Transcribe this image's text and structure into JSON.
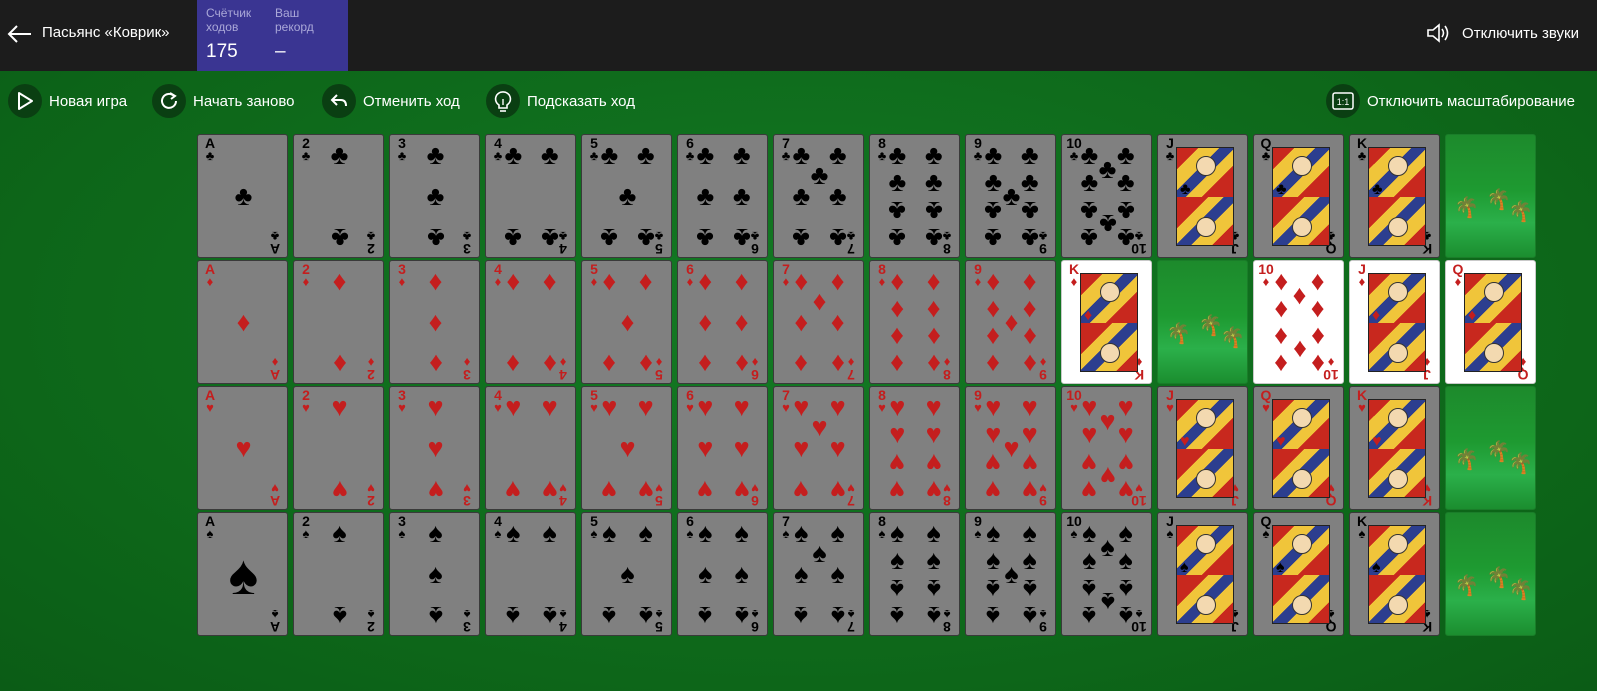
{
  "header": {
    "back_icon": "arrow-left-icon",
    "title": "Пасьянс «Коврик»",
    "moves_label": "Счётчик\nходов",
    "moves_value": "175",
    "record_label": "Ваш\nрекорд",
    "record_value": "–",
    "sound_label": "Отключить звуки",
    "sound_icon": "speaker-icon"
  },
  "toolbar": {
    "new_game": "Новая игра",
    "restart": "Начать заново",
    "undo": "Отменить ход",
    "hint": "Подсказать ход",
    "scaling": "Отключить масштабирование",
    "scaling_icon_text": "1:1"
  },
  "colors": {
    "felt": "#0f6a1c",
    "topbar": "#1c1c1c",
    "counter_bg": "#3a3592",
    "red_suit": "#c41e1e",
    "black_suit": "#000000"
  },
  "board": {
    "rows": [
      [
        "A♣",
        "2♣",
        "3♣",
        "4♣",
        "5♣",
        "6♣",
        "7♣",
        "8♣",
        "9♣",
        "10♣",
        "J♣",
        "Q♣",
        "K♣",
        "empty"
      ],
      [
        "A♦",
        "2♦",
        "3♦",
        "4♦",
        "5♦",
        "6♦",
        "7♦",
        "8♦",
        "9♦",
        "K♦*",
        "empty",
        "10♦*",
        "J♦*",
        "Q♦*"
      ],
      [
        "A♥",
        "2♥",
        "3♥",
        "4♥",
        "5♥",
        "6♥",
        "7♥",
        "8♥",
        "9♥",
        "10♥",
        "J♥",
        "Q♥",
        "K♥",
        "empty"
      ],
      [
        "A♠",
        "2♠",
        "3♠",
        "4♠",
        "5♠",
        "6♠",
        "7♠",
        "8♠",
        "9♠",
        "10♠",
        "J♠",
        "Q♠",
        "K♠",
        "empty"
      ]
    ]
  }
}
